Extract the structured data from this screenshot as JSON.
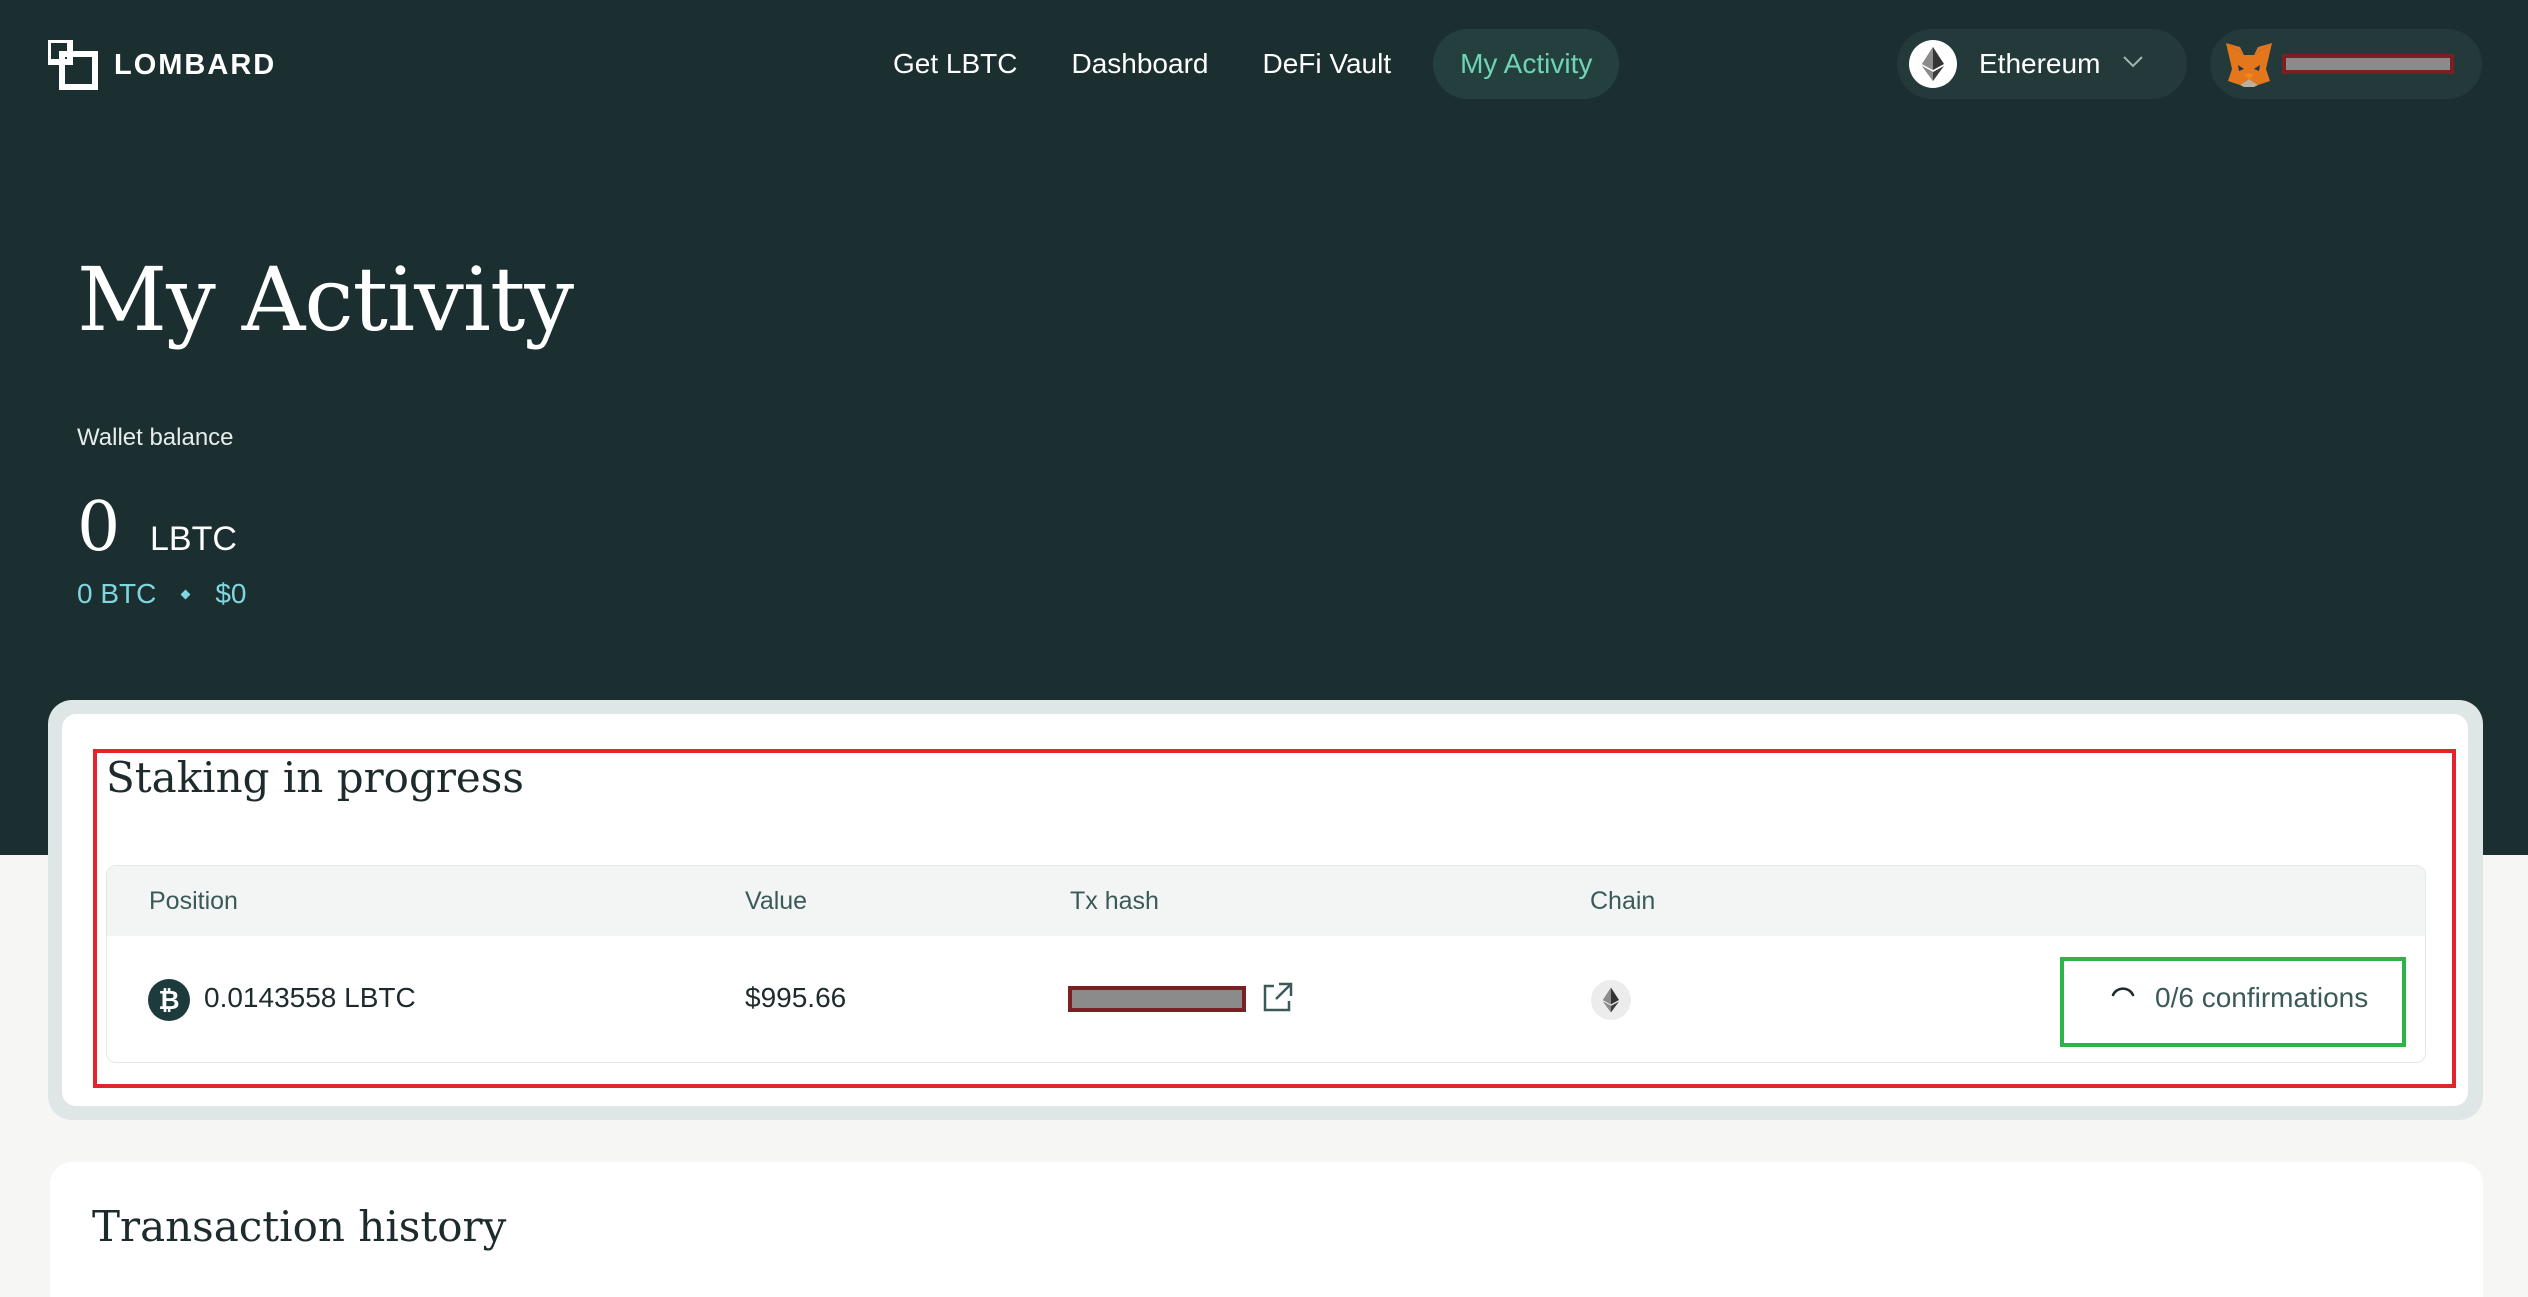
{
  "nav": {
    "brand": "LOMBARD",
    "links": [
      "Get LBTC",
      "Dashboard",
      "DeFi Vault",
      "My Activity"
    ],
    "active_link": "My Activity",
    "chain": "Ethereum"
  },
  "hero": {
    "title": "My Activity",
    "wallet_balance_label": "Wallet balance",
    "balance_amount": "0",
    "balance_unit": "LBTC",
    "balance_btc": "0 BTC",
    "balance_usd": "$0"
  },
  "staking": {
    "title": "Staking in progress",
    "columns": [
      "Position",
      "Value",
      "Tx hash",
      "Chain"
    ],
    "row": {
      "position": "0.0143558 LBTC",
      "value": "$995.66",
      "chain_icon": "ethereum-icon",
      "status": "0/6 confirmations"
    }
  },
  "history": {
    "title": "Transaction history"
  },
  "colors": {
    "header_bg": "#1b2e30",
    "accent": "#6fd3b6",
    "highlight_red": "#e3242b",
    "highlight_green": "#2db34a"
  }
}
